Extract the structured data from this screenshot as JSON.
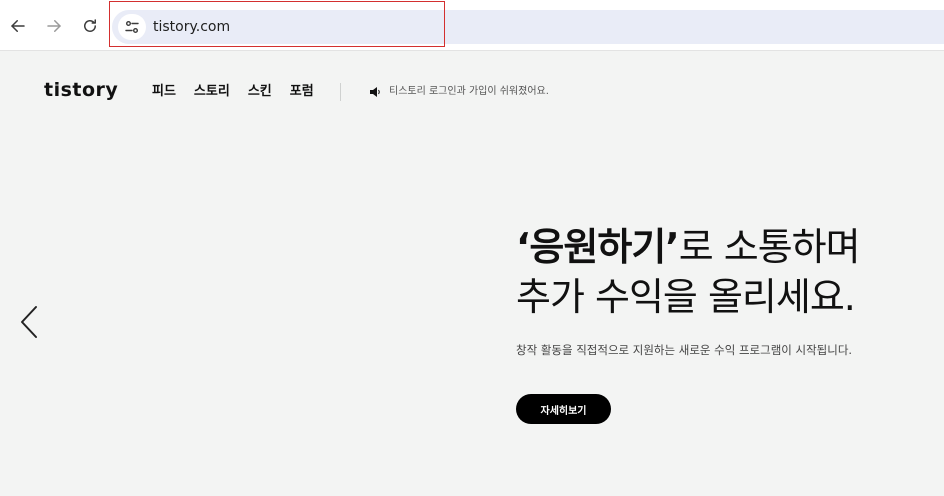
{
  "browser": {
    "url": "tistory.com"
  },
  "header": {
    "logo": "tistory",
    "nav": [
      "피드",
      "스토리",
      "스킨",
      "포럼"
    ],
    "notice": "티스토리 로그인과 가입이 쉬워졌어요."
  },
  "hero": {
    "title_strong": "‘응원하기’",
    "title_rest": "로 소통하며",
    "title_line2": "추가 수익을 올리세요.",
    "description": "창작 활동을 직접적으로 지원하는 새로운 수익 프로그램이 시작됩니다.",
    "cta_label": "자세히보기"
  },
  "colors": {
    "page_background": "#f3f4f3",
    "cta_background": "#000000",
    "omnibox_background": "#e9ecf7",
    "highlight_border": "#d32f2f"
  },
  "icons": [
    "back-arrow-icon",
    "forward-arrow-icon",
    "reload-icon",
    "site-settings-icon",
    "speaker-icon",
    "chevron-left-icon"
  ]
}
